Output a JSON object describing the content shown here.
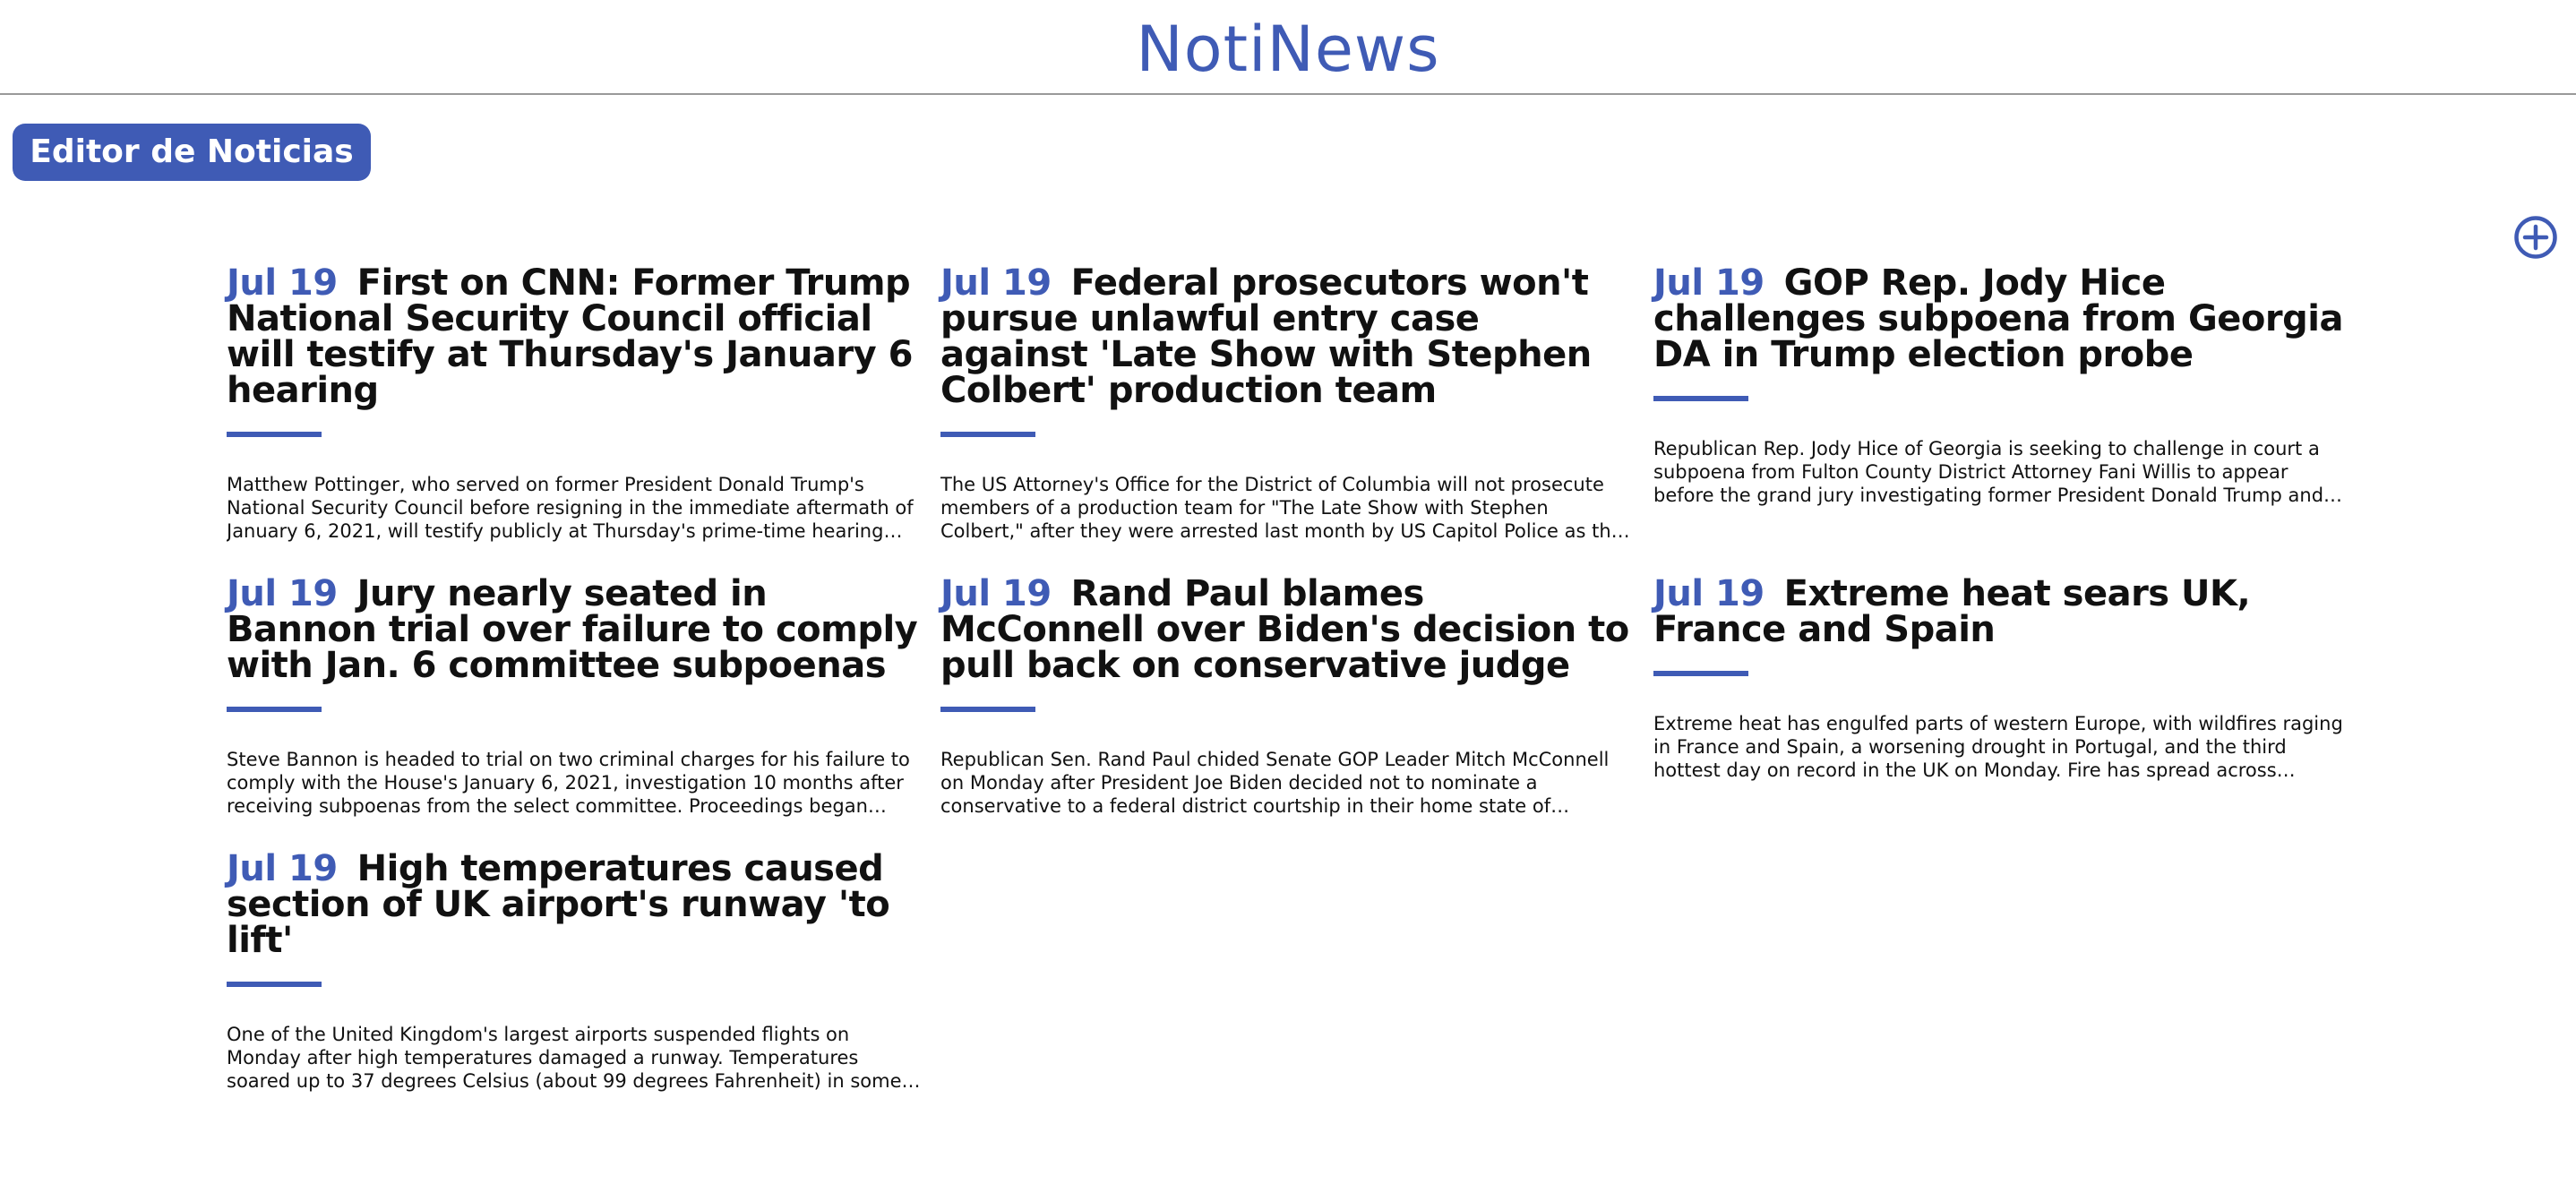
{
  "header": {
    "title": "NotiNews"
  },
  "toolbar": {
    "editor_label": "Editor de Noticias",
    "add_icon": "plus-circle-icon"
  },
  "accent_color": "#3f5bb5",
  "articles": [
    {
      "date": "Jul 19",
      "title": "First on CNN: Former Trump National Security Council official will testify at Thursday's January 6 hearing",
      "summary": "Matthew Pottinger, who served on former President Donald Trump's National Security Council before resigning in the immediate aftermath of January 6, 2021, will testify publicly at Thursday's prime-time hearing held by..."
    },
    {
      "date": "Jul 19",
      "title": "Federal prosecutors won't pursue unlawful entry case against 'Late Show with Stephen Colbert' production team",
      "summary": "The US Attorney's Office for the District of Columbia will not prosecute members of a production team for \"The Late Show with Stephen Colbert,\" after they were arrested last month by US Capitol Police as the team filmed ..."
    },
    {
      "date": "Jul 19",
      "title": "GOP Rep. Jody Hice challenges subpoena from Georgia DA in Trump election probe",
      "summary": "Republican Rep. Jody Hice of Georgia is seeking to challenge in court a subpoena from Fulton County District Attorney Fani Willis to appear before the grand jury investigating former President Donald Trump and his efforts..."
    },
    {
      "date": "Jul 19",
      "title": "Jury nearly seated in Bannon trial over failure to comply with Jan. 6 committee subpoenas",
      "summary": "Steve Bannon is headed to trial on two criminal charges for his failure to comply with the House's January 6, 2021, investigation 10 months after receiving subpoenas from the select committee. Proceedings began Monda..."
    },
    {
      "date": "Jul 19",
      "title": "Rand Paul blames McConnell over Biden's decision to pull back on conservative judge",
      "summary": "Republican Sen. Rand Paul chided Senate GOP Leader Mitch McConnell on Monday after President Joe Biden decided not to nominate a conservative to a federal district courtship in their home state of Kentucky, intensifying a..."
    },
    {
      "date": "Jul 19",
      "title": "Extreme heat sears UK, France and Spain",
      "summary": "Extreme heat has engulfed parts of western Europe, with wildfires raging in France and Spain, a worsening drought in Portugal, and the third hottest day on record in the UK on Monday. Fire has spread across thousands of acres in..."
    },
    {
      "date": "Jul 19",
      "title": "High temperatures caused section of UK airport's runway 'to lift'",
      "summary": "One of the United Kingdom's largest airports suspended flights on Monday after high temperatures damaged a runway. Temperatures soared up to 37 degrees Celsius (about 99 degrees Fahrenheit) in some parts of the country...."
    }
  ]
}
